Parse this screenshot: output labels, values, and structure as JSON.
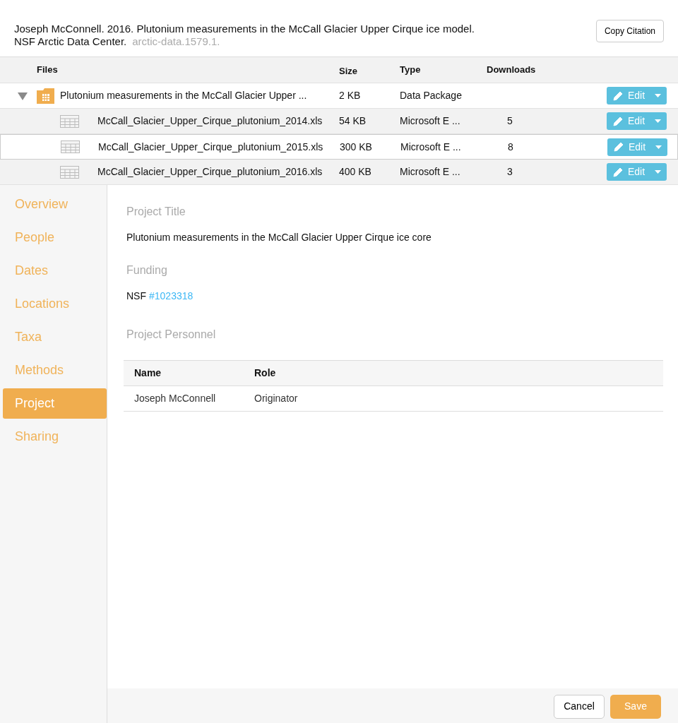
{
  "citation": {
    "text": "Joseph McConnell. 2016. Plutonium measurements in the McCall Glacier Upper Cirque ice model.",
    "publisher": "NSF Arctic Data Center.",
    "identifier": "arctic-data.1579.1.",
    "button": "Copy Citation"
  },
  "files": {
    "columns": [
      "Files",
      "Size",
      "Type",
      "Downloads"
    ],
    "rows": [
      {
        "kind": "package",
        "expanded": true,
        "selected": false,
        "name": "Plutonium measurements in the McCall Glacier Upper ...",
        "size": "2 KB",
        "type": "Data Package",
        "edit": "Edit"
      },
      {
        "kind": "file",
        "selected": false,
        "name": "McCall_Glacier_Upper_Cirque_plutonium_2014.xls",
        "size": "54 KB",
        "type": "Microsoft E ...",
        "downloads": "5",
        "edit": "Edit"
      },
      {
        "kind": "file",
        "selected": true,
        "name": "McCall_Glacier_Upper_Cirque_plutonium_2015.xls",
        "size": "300 KB",
        "type": "Microsoft E ...",
        "downloads": "8",
        "edit": "Edit"
      },
      {
        "kind": "file",
        "selected": false,
        "name": "McCall_Glacier_Upper_Cirque_plutonium_2016.xls",
        "size": "400 KB",
        "type": "Microsoft E ...",
        "downloads": "3",
        "edit": "Edit"
      }
    ]
  },
  "sidebar": {
    "items": [
      {
        "label": "Overview",
        "selected": false
      },
      {
        "label": "People",
        "selected": false
      },
      {
        "label": "Dates",
        "selected": false
      },
      {
        "label": "Locations",
        "selected": false
      },
      {
        "label": "Taxa",
        "selected": false
      },
      {
        "label": "Methods",
        "selected": false
      },
      {
        "label": "Project",
        "selected": true
      },
      {
        "label": "Sharing",
        "selected": false
      }
    ]
  },
  "project": {
    "title_label": "Project Title",
    "title": "Plutonium measurements in the McCall Glacier Upper Cirque ice core",
    "funding_label": "Funding",
    "funder": "NSF",
    "award": "#1023318",
    "personnel_label": "Project Personnel",
    "personnel": {
      "columns": [
        "Name",
        "Role"
      ],
      "rows": [
        [
          "Joseph McConnell",
          "Originator"
        ]
      ]
    }
  },
  "footer": {
    "cancel": "Cancel",
    "save": "Save"
  }
}
